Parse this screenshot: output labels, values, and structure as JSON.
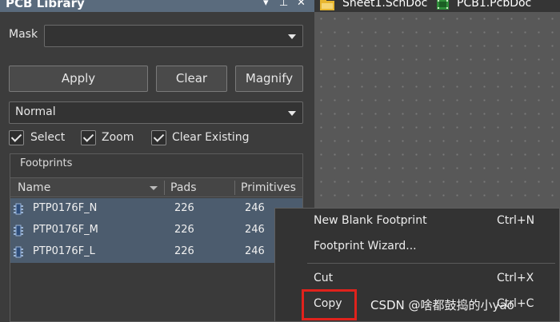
{
  "panel": {
    "title": "PCB Library",
    "header_icons": {
      "dropdown": "▾",
      "pin": "⊥",
      "close": "✕"
    },
    "mask": {
      "label": "Mask",
      "value": ""
    },
    "buttons": {
      "apply": "Apply",
      "clear": "Clear",
      "magnify": "Magnify"
    },
    "mode_select": {
      "value": "Normal"
    },
    "checkboxes": [
      {
        "label": "Select",
        "checked": true
      },
      {
        "label": "Zoom",
        "checked": true
      },
      {
        "label": "Clear Existing",
        "checked": true
      }
    ],
    "footprints": {
      "title": "Footprints",
      "columns": {
        "name": "Name",
        "pads": "Pads",
        "primitives": "Primitives"
      },
      "rows": [
        {
          "name": "PTP0176F_N",
          "pads": "226",
          "primitives": "246"
        },
        {
          "name": "PTP0176F_M",
          "pads": "226",
          "primitives": "246"
        },
        {
          "name": "PTP0176F_L",
          "pads": "226",
          "primitives": "246"
        }
      ]
    }
  },
  "tabs": [
    {
      "label": "Sheet1.SchDoc",
      "icon": "schematic-doc-icon"
    },
    {
      "label": "PCB1.PcbDoc",
      "icon": "pcb-doc-icon"
    }
  ],
  "context_menu": {
    "items": [
      {
        "label": "New Blank Footprint",
        "shortcut": "Ctrl+N"
      },
      {
        "label": "Footprint Wizard...",
        "shortcut": ""
      },
      {
        "label": "Cut",
        "shortcut": "Ctrl+X"
      },
      {
        "label": "Copy",
        "shortcut": "Ctrl+C"
      }
    ]
  },
  "watermark": "CSDN @啥都鼓捣的小yao",
  "colors": {
    "panel_header": "#5a6b7d",
    "selection_row": "#4c5c6e",
    "highlight_box": "#e0221c",
    "canvas": "#585858"
  }
}
